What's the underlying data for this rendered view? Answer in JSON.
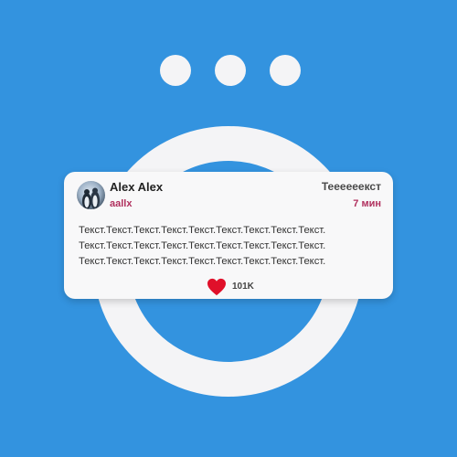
{
  "post": {
    "author_name": "Alex Alex",
    "author_handle": "aallx",
    "title": "Теееееекст",
    "time": "7 мин",
    "lines": [
      "Текст.Текст.Текст.Текст.Текст.Текст.Текст.Текст.Текст.",
      "Текст.Текст.Текст.Текст.Текст.Текст.Текст.Текст.Текст.",
      "Текст.Текст.Текст.Текст.Текст.Текст.Текст.Текст.Текст."
    ],
    "likes": "101K"
  },
  "icons": {
    "more": "three-dots-icon",
    "like": "heart-icon"
  },
  "colors": {
    "background": "#3393DF",
    "accent": "#B0305E",
    "heart": "#E0102A"
  }
}
